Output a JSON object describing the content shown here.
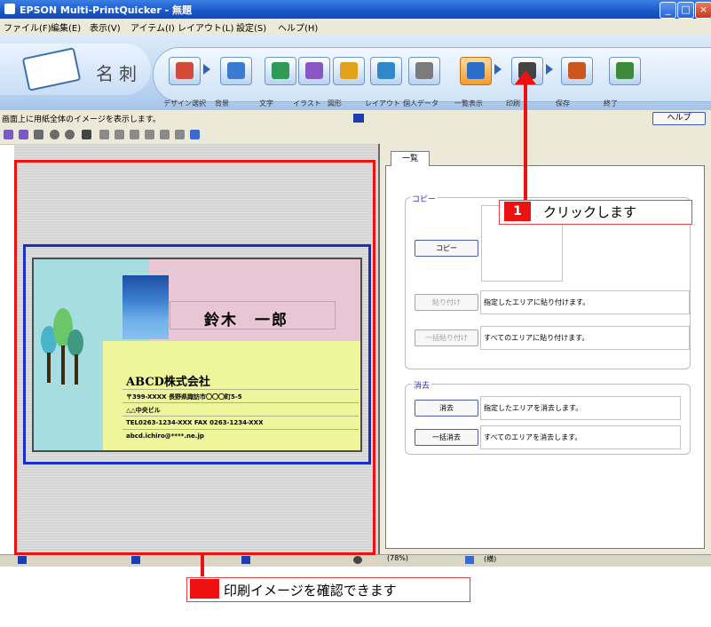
{
  "window": {
    "title": "EPSON Multi-PrintQuicker - 無題"
  },
  "menu": [
    "ファイル(F)",
    "編集(E)",
    "表示(V)",
    "アイテム(I)",
    "レイアウト(L)",
    "設定(S)",
    "ヘルプ(H)"
  ],
  "app": {
    "name": "名刺"
  },
  "tools": [
    {
      "label": "デザイン選択",
      "icon": "design-select-icon"
    },
    {
      "label": "背景",
      "icon": "background-icon"
    },
    {
      "label": "文字",
      "icon": "text-icon"
    },
    {
      "label": "イラスト",
      "icon": "illustration-icon"
    },
    {
      "label": "図形",
      "icon": "shape-icon"
    },
    {
      "label": "レイアウト",
      "icon": "layout-icon"
    },
    {
      "label": "個人データ",
      "icon": "personal-data-icon"
    },
    {
      "label": "一覧表示",
      "icon": "list-view-icon",
      "active": true
    },
    {
      "label": "印刷",
      "icon": "print-icon"
    },
    {
      "label": "保存",
      "icon": "save-icon"
    },
    {
      "label": "終了",
      "icon": "exit-icon"
    }
  ],
  "status": {
    "message": "画面上に用紙全体のイメージを表示します。",
    "help": "ヘルプ"
  },
  "card": {
    "name": "鈴木　一郎",
    "company": "ABCD株式会社",
    "lines": [
      "〒399-XXXX 長野県諏訪市〇〇〇町5-5",
      "△△中央ビル",
      "TEL0263-1234-XXX FAX 0263-1234-XXX",
      "abcd.ichiro@****.ne.jp"
    ]
  },
  "panel": {
    "tab": "一覧",
    "copy_group": "コピー",
    "copy_button": "コピー",
    "paste_button": "貼り付け",
    "paste_desc": "指定したエリアに貼り付けます。",
    "paste_all_button": "一括貼り付け",
    "paste_all_desc": "すべてのエリアに貼り付けます。",
    "erase_group": "消去",
    "erase_button": "消去",
    "erase_desc": "指定したエリアを消去します。",
    "erase_all_button": "一括消去",
    "erase_all_desc": "すべてのエリアを消去します。"
  },
  "bottom": {
    "zoom": "(78%)",
    "orientation": "(横)"
  },
  "callouts": {
    "step_number": "1",
    "step_text": "クリックします",
    "preview_text": "印刷イメージを確認できます"
  },
  "colors": {
    "accent_red": "#e11111",
    "frame_blue": "#1a2fc8"
  }
}
